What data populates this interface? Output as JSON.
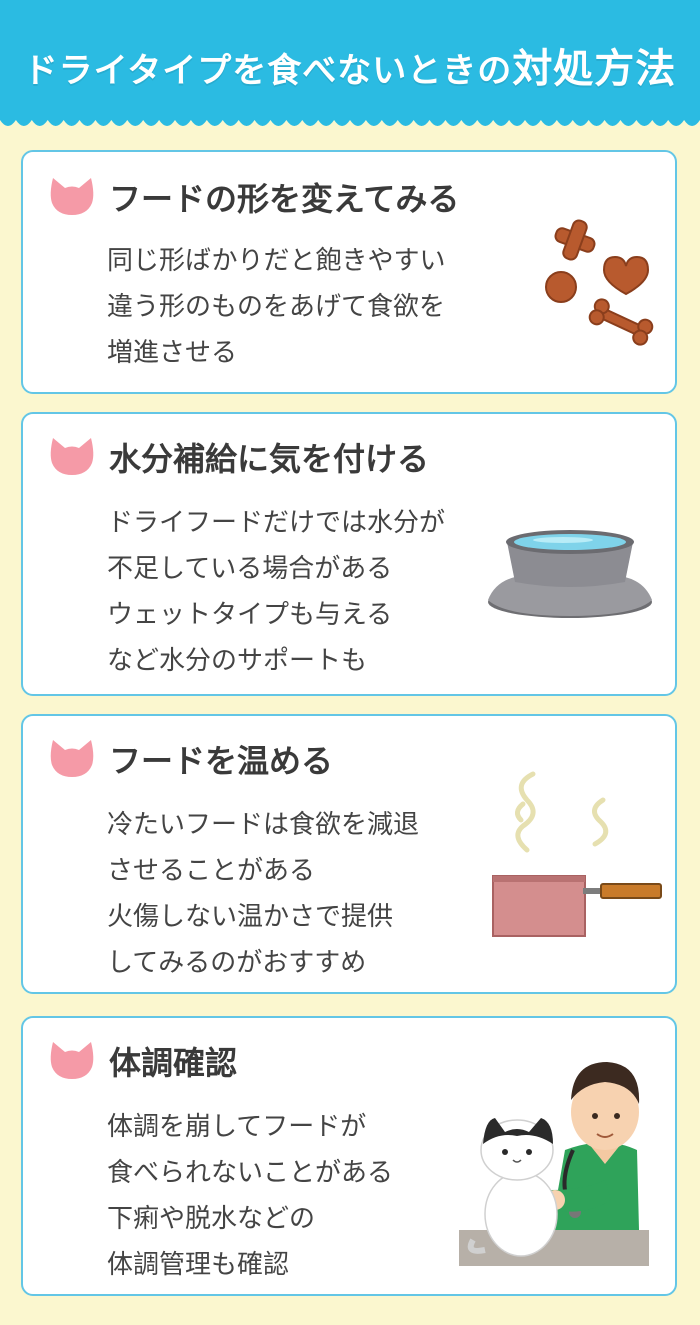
{
  "header": {
    "title_small": "ドライタイプを食べないときの",
    "title_big": "対処方法"
  },
  "colors": {
    "header": "#2bbbe2",
    "background": "#fbf7cf",
    "card_border": "#63c6e6",
    "cat_icon": "#f59aa7"
  },
  "cards": [
    {
      "title": "フードの形を変えてみる",
      "lines": [
        "同じ形ばかりだと飽きやすい",
        "違う形のものをあげて食欲を",
        "増進させる"
      ],
      "icon": "cat-icon",
      "illustration": "kibble-shapes-illustration"
    },
    {
      "title": "水分補給に気を付ける",
      "lines": [
        "ドライフードだけでは水分が",
        "不足している場合がある",
        "ウェットタイプも与える",
        "など水分のサポートも"
      ],
      "icon": "cat-icon",
      "illustration": "water-bowl-illustration"
    },
    {
      "title": "フードを温める",
      "lines": [
        "冷たいフードは食欲を減退",
        "させることがある",
        "火傷しない温かさで提供",
        "してみるのがおすすめ"
      ],
      "icon": "cat-icon",
      "illustration": "saucepan-steam-illustration"
    },
    {
      "title": "体調確認",
      "lines": [
        "体調を崩してフードが",
        "食べられないことがある",
        "下痢や脱水などの",
        "体調管理も確認"
      ],
      "icon": "cat-icon",
      "illustration": "vet-with-cat-illustration"
    }
  ]
}
